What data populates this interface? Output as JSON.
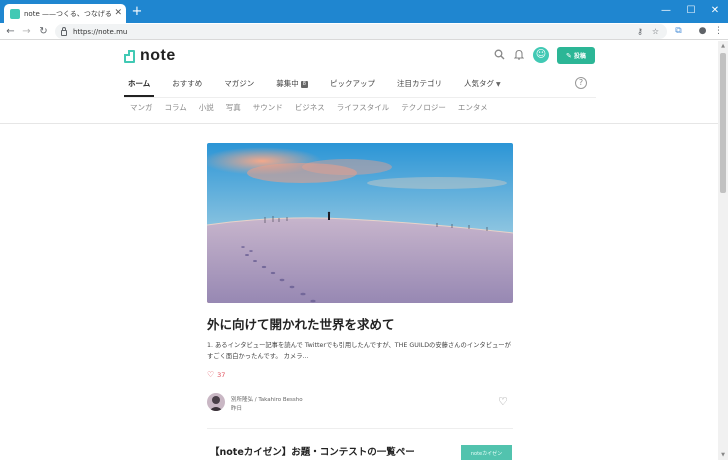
{
  "browser": {
    "tab_title": "note ——つくる、つなげる、とどける。",
    "url": "https://note.mu"
  },
  "header": {
    "logo_text": "note",
    "post_button_label": "投稿"
  },
  "main_nav": [
    "ホーム",
    "おすすめ",
    "マガジン",
    "募集中",
    "ピックアップ",
    "注目カテゴリ",
    "人気タグ"
  ],
  "main_nav_badge": "8",
  "sub_nav": [
    "マンガ",
    "コラム",
    "小説",
    "写真",
    "サウンド",
    "ビジネス",
    "ライフスタイル",
    "テクノロジー",
    "エンタメ"
  ],
  "article": {
    "title": "外に向けて開かれた世界を求めて",
    "excerpt": "1. あるインタビュー記事を読んで Twitterでも引用したんですが、THE GUILDの安藤さんのインタビューがすごく面白かったんです。 カメラ...",
    "likes": "37",
    "author": "別所隆弘 / Takahiro Bessho",
    "date": "昨日"
  },
  "next_article": {
    "title": "【noteカイゼン】お題・コンテストの一覧ペー",
    "thumb_label": "noteカイゼン"
  },
  "colors": {
    "brand": "#41c9b4",
    "post_button": "#2cb696",
    "like": "#e04e5a",
    "titlebar": "#1f86d0"
  }
}
